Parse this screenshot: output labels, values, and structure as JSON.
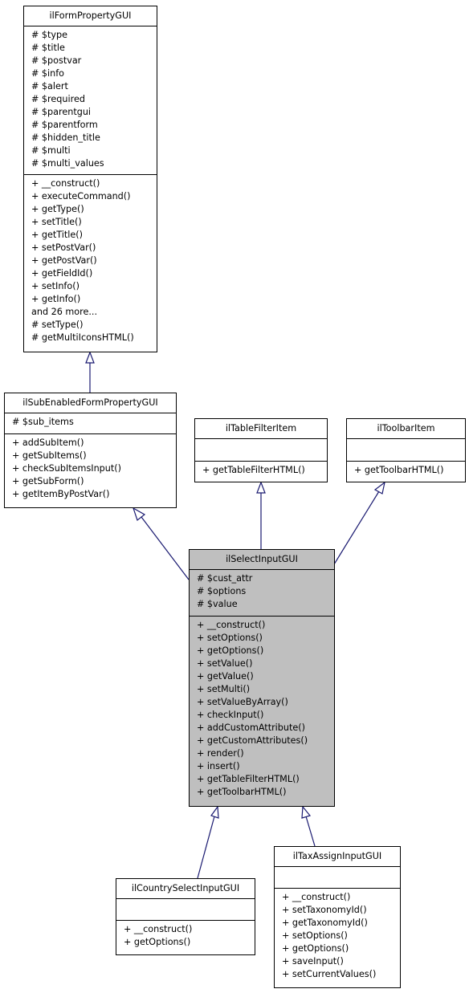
{
  "colors": {
    "edge": "#191970",
    "highlight": "#bfbfbf",
    "border": "#000000"
  },
  "classes": {
    "formprop": {
      "name": "ilFormPropertyGUI",
      "attributes": [
        "# $type",
        "# $title",
        "# $postvar",
        "# $info",
        "# $alert",
        "# $required",
        "# $parentgui",
        "# $parentform",
        "# $hidden_title",
        "# $multi",
        "# $multi_values"
      ],
      "methods": [
        "+ __construct()",
        "+ executeCommand()",
        "+ getType()",
        "+ setTitle()",
        "+ getTitle()",
        "+ setPostVar()",
        "+ getPostVar()",
        "+ getFieldId()",
        "+ setInfo()",
        "+ getInfo()",
        "and 26 more...",
        "# setType()",
        "# getMultiIconsHTML()"
      ]
    },
    "subenabled": {
      "name": "ilSubEnabledFormPropertyGUI",
      "attributes": [
        "# $sub_items"
      ],
      "methods": [
        "+ addSubItem()",
        "+ getSubItems()",
        "+ checkSubItemsInput()",
        "+ getSubForm()",
        "+ getItemByPostVar()"
      ]
    },
    "tablefilter": {
      "name": "ilTableFilterItem",
      "attributes": [],
      "methods": [
        "+ getTableFilterHTML()"
      ]
    },
    "toolbar": {
      "name": "ilToolbarItem",
      "attributes": [],
      "methods": [
        "+ getToolbarHTML()"
      ]
    },
    "selectinput": {
      "name": "ilSelectInputGUI",
      "attributes": [
        "# $cust_attr",
        "# $options",
        "# $value"
      ],
      "methods": [
        "+ __construct()",
        "+ setOptions()",
        "+ getOptions()",
        "+ setValue()",
        "+ getValue()",
        "+ setMulti()",
        "+ setValueByArray()",
        "+ checkInput()",
        "+ addCustomAttribute()",
        "+ getCustomAttributes()",
        "+ render()",
        "+ insert()",
        "+ getTableFilterHTML()",
        "+ getToolbarHTML()"
      ]
    },
    "country": {
      "name": "ilCountrySelectInputGUI",
      "attributes": [],
      "methods": [
        "+ __construct()",
        "+ getOptions()"
      ]
    },
    "taxassign": {
      "name": "ilTaxAssignInputGUI",
      "attributes": [],
      "methods": [
        "+ __construct()",
        "+ setTaxonomyId()",
        "+ getTaxonomyId()",
        "+ setOptions()",
        "+ getOptions()",
        "+ saveInput()",
        "+ setCurrentValues()"
      ]
    }
  },
  "inheritance": [
    {
      "child": "ilSubEnabledFormPropertyGUI",
      "parent": "ilFormPropertyGUI"
    },
    {
      "child": "ilSelectInputGUI",
      "parent": "ilSubEnabledFormPropertyGUI"
    },
    {
      "child": "ilSelectInputGUI",
      "parent": "ilTableFilterItem"
    },
    {
      "child": "ilSelectInputGUI",
      "parent": "ilToolbarItem"
    },
    {
      "child": "ilCountrySelectInputGUI",
      "parent": "ilSelectInputGUI"
    },
    {
      "child": "ilTaxAssignInputGUI",
      "parent": "ilSelectInputGUI"
    }
  ]
}
